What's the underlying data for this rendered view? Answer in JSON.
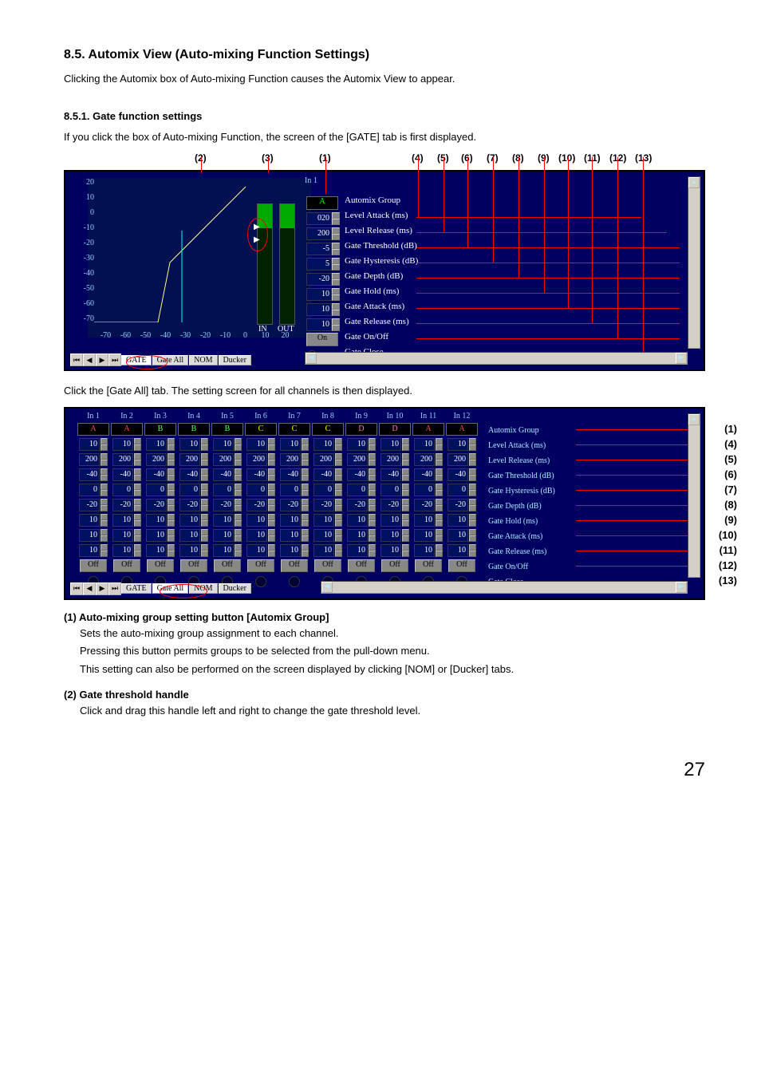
{
  "h2": "8.5. Automix View (Auto-mixing Function Settings)",
  "intro": "Clicking the Automix box of Auto-mixing Function causes the Automix View to appear.",
  "h3": "8.5.1. Gate function settings",
  "p1": "If you click the box of Auto-mixing Function, the screen of the [GATE] tab is first displayed.",
  "callouts1": {
    "c2": "(2)",
    "c3": "(3)",
    "c1": "(1)",
    "c4": "(4)",
    "c5": "(5)",
    "c6": "(6)",
    "c7": "(7)",
    "c8": "(8)",
    "c9": "(9)",
    "c10": "(10)",
    "c11": "(11)",
    "c12": "(12)",
    "c13": "(13)"
  },
  "scaley": [
    "20",
    "10",
    "0",
    "-10",
    "-20",
    "-30",
    "-40",
    "-50",
    "-60",
    "-70"
  ],
  "scalex": [
    "-70",
    "-60",
    "-50",
    "-40",
    "-30",
    "-20",
    "-10",
    "0",
    "10",
    "20"
  ],
  "inout": {
    "in": "IN",
    "out": "OUT"
  },
  "chlabel": "In 1",
  "gateParams": [
    {
      "label": "Automix Group",
      "val": "A",
      "type": "group"
    },
    {
      "label": "Level Attack (ms)",
      "val": "020"
    },
    {
      "label": "Level Release (ms)",
      "val": "200"
    },
    {
      "label": "Gate Threshold (dB)",
      "val": "-5"
    },
    {
      "label": "Gate Hysteresis (dB)",
      "val": "5"
    },
    {
      "label": "Gate Depth (dB)",
      "val": "-20"
    },
    {
      "label": "Gate Hold (ms)",
      "val": "10"
    },
    {
      "label": "Gate Attack (ms)",
      "val": "10"
    },
    {
      "label": "Gate Release (ms)",
      "val": "10"
    },
    {
      "label": "Gate On/Off",
      "val": "On",
      "type": "btn"
    },
    {
      "label": "Gate Close",
      "type": "led"
    }
  ],
  "tabs": [
    "GATE",
    "Gate All",
    "NOM",
    "Ducker"
  ],
  "p2": "Click the [Gate All] tab. The setting screen for all channels is then displayed.",
  "channels": [
    "In 1",
    "In 2",
    "In 3",
    "In 4",
    "In 5",
    "In 6",
    "In 7",
    "In 8",
    "In 9",
    "In 10",
    "In 11",
    "In 12"
  ],
  "groups": [
    "A",
    "A",
    "B",
    "B",
    "B",
    "C",
    "C",
    "C",
    "D",
    "D",
    "A",
    "A"
  ],
  "rows2": [
    {
      "label": "Automix Group",
      "type": "group",
      "side": "(1)"
    },
    {
      "label": "Level Attack (ms)",
      "vals": [
        "10",
        "10",
        "10",
        "10",
        "10",
        "10",
        "10",
        "10",
        "10",
        "10",
        "10",
        "10"
      ],
      "side": "(4)"
    },
    {
      "label": "Level Release (ms)",
      "vals": [
        "200",
        "200",
        "200",
        "200",
        "200",
        "200",
        "200",
        "200",
        "200",
        "200",
        "200",
        "200"
      ],
      "side": "(5)"
    },
    {
      "label": "Gate Threshold (dB)",
      "vals": [
        "-40",
        "-40",
        "-40",
        "-40",
        "-40",
        "-40",
        "-40",
        "-40",
        "-40",
        "-40",
        "-40",
        "-40"
      ],
      "side": "(6)"
    },
    {
      "label": "Gate Hysteresis (dB)",
      "vals": [
        "0",
        "0",
        "0",
        "0",
        "0",
        "0",
        "0",
        "0",
        "0",
        "0",
        "0",
        "0"
      ],
      "side": "(7)"
    },
    {
      "label": "Gate Depth (dB)",
      "vals": [
        "-20",
        "-20",
        "-20",
        "-20",
        "-20",
        "-20",
        "-20",
        "-20",
        "-20",
        "-20",
        "-20",
        "-20"
      ],
      "side": "(8)"
    },
    {
      "label": "Gate Hold (ms)",
      "vals": [
        "10",
        "10",
        "10",
        "10",
        "10",
        "10",
        "10",
        "10",
        "10",
        "10",
        "10",
        "10"
      ],
      "side": "(9)"
    },
    {
      "label": "Gate Attack (ms)",
      "vals": [
        "10",
        "10",
        "10",
        "10",
        "10",
        "10",
        "10",
        "10",
        "10",
        "10",
        "10",
        "10"
      ],
      "side": "(10)"
    },
    {
      "label": "Gate Release (ms)",
      "vals": [
        "10",
        "10",
        "10",
        "10",
        "10",
        "10",
        "10",
        "10",
        "10",
        "10",
        "10",
        "10"
      ],
      "side": "(11)"
    },
    {
      "label": "Gate On/Off",
      "type": "off",
      "val": "Off",
      "side": "(12)"
    },
    {
      "label": "Gate Close",
      "type": "led",
      "side": "(13)"
    }
  ],
  "desc1h": "(1) Auto-mixing group setting button [Automix Group]",
  "desc1a": "Sets the auto-mixing group assignment to each channel.",
  "desc1b": "Pressing this button permits groups to be selected from the pull-down menu.",
  "desc1c": "This setting can also be performed on the screen displayed by clicking [NOM] or [Ducker] tabs.",
  "desc2h": "(2) Gate threshold handle",
  "desc2a": "Click and drag this handle left and right to change the gate threshold level.",
  "pgnum": "27"
}
